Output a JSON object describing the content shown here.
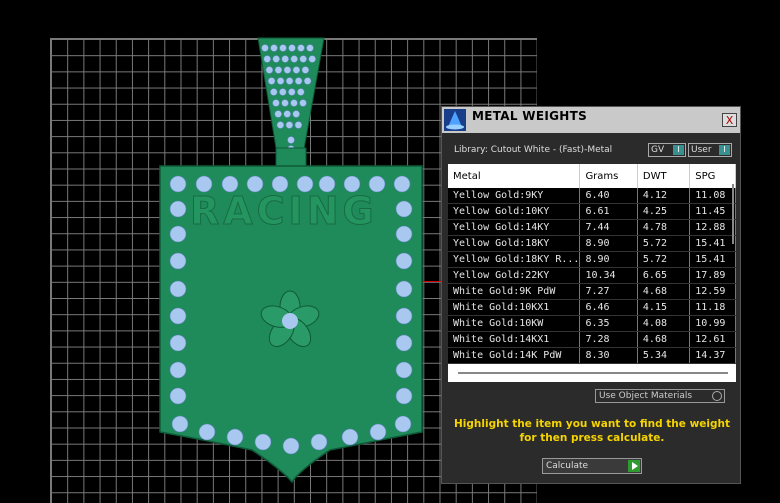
{
  "window": {
    "title": "METAL WEIGHTS",
    "close_label": "X"
  },
  "library": {
    "label": "Library: Cutout White - (Fast)-Metal"
  },
  "toggles": {
    "gv": {
      "label": "GV",
      "indicator": "I"
    },
    "user": {
      "label": "User",
      "indicator": "I"
    }
  },
  "table": {
    "headers": [
      "Metal",
      "Grams",
      "DWT",
      "SPG"
    ],
    "rows": [
      [
        "Yellow Gold:9KY",
        "6.40",
        "4.12",
        "11.08"
      ],
      [
        "Yellow Gold:10KY",
        "6.61",
        "4.25",
        "11.45"
      ],
      [
        "Yellow Gold:14KY",
        "7.44",
        "4.78",
        "12.88"
      ],
      [
        "Yellow Gold:18KY",
        "8.90",
        "5.72",
        "15.41"
      ],
      [
        "Yellow Gold:18KY R...",
        "8.90",
        "5.72",
        "15.41"
      ],
      [
        "Yellow Gold:22KY",
        "10.34",
        "6.65",
        "17.89"
      ],
      [
        "White Gold:9K PdW",
        "7.27",
        "4.68",
        "12.59"
      ],
      [
        "White Gold:10KX1",
        "6.46",
        "4.15",
        "11.18"
      ],
      [
        "White Gold:10KW",
        "6.35",
        "4.08",
        "10.99"
      ],
      [
        "White Gold:14KX1",
        "7.28",
        "4.68",
        "12.61"
      ],
      [
        "White Gold:14K PdW",
        "8.30",
        "5.34",
        "14.37"
      ]
    ]
  },
  "use_object_materials": {
    "label": "Use Object Materials"
  },
  "hint": {
    "line1": "Highlight the item you want to find the weight",
    "line2": "for then press calculate."
  },
  "calculate": {
    "label": "Calculate"
  },
  "colors": {
    "model_green": "#1f8a5a",
    "gem_blue": "#a9c8f0",
    "hint_yellow": "#f5d400"
  },
  "model": {
    "engraving": "RACING"
  }
}
